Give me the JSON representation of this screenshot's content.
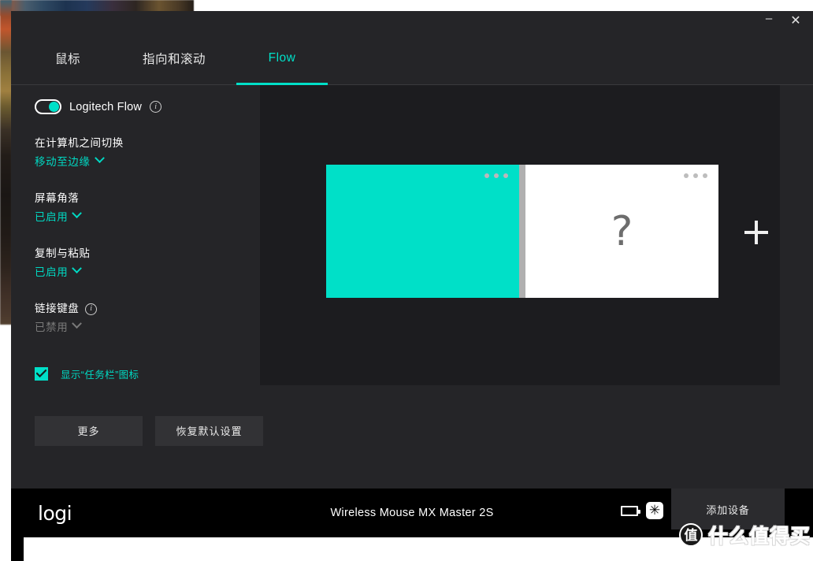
{
  "window": {
    "minimize_label": "–",
    "close_label": "✕"
  },
  "tabs": [
    {
      "label": "鼠标",
      "active": false
    },
    {
      "label": "指向和滚动",
      "active": false
    },
    {
      "label": "Flow",
      "active": true
    }
  ],
  "flow": {
    "toggle_label": "Logitech Flow",
    "toggle_on": true,
    "info_icon": "info-icon",
    "settings": [
      {
        "title": "在计算机之间切换",
        "value": "移动至边缘",
        "disabled": false,
        "has_info": false
      },
      {
        "title": "屏幕角落",
        "value": "已启用",
        "disabled": false,
        "has_info": false
      },
      {
        "title": "复制与粘贴",
        "value": "已启用",
        "disabled": false,
        "has_info": false
      },
      {
        "title": "链接键盘",
        "value": "已禁用",
        "disabled": true,
        "has_info": true
      }
    ],
    "checkbox": {
      "label": "显示“任务栏”图标",
      "checked": true
    },
    "buttons": {
      "more": "更多",
      "reset": "恢复默认设置"
    }
  },
  "preview": {
    "screens": [
      {
        "id": "screen-a",
        "kind": "active",
        "menu_icon": "ellipsis-icon"
      },
      {
        "id": "screen-b",
        "kind": "unknown",
        "placeholder": "?",
        "menu_icon": "ellipsis-icon"
      }
    ],
    "add_button_icon": "plus-icon"
  },
  "device_bar": {
    "brand": "logi",
    "device_name": "Wireless Mouse MX Master 2S",
    "battery_icon": "battery-icon",
    "receiver_icon": "unifying-receiver-icon",
    "receiver_glyph": "✳",
    "add_device_label": "添加设备"
  },
  "watermark": {
    "badge": "值",
    "text": "什么值得买"
  },
  "colors": {
    "accent": "#00e0c8",
    "accent_text": "#00d8c2",
    "window_bg": "#252528",
    "panel_bg": "#1c1c1f",
    "bar_bg": "#000000"
  }
}
